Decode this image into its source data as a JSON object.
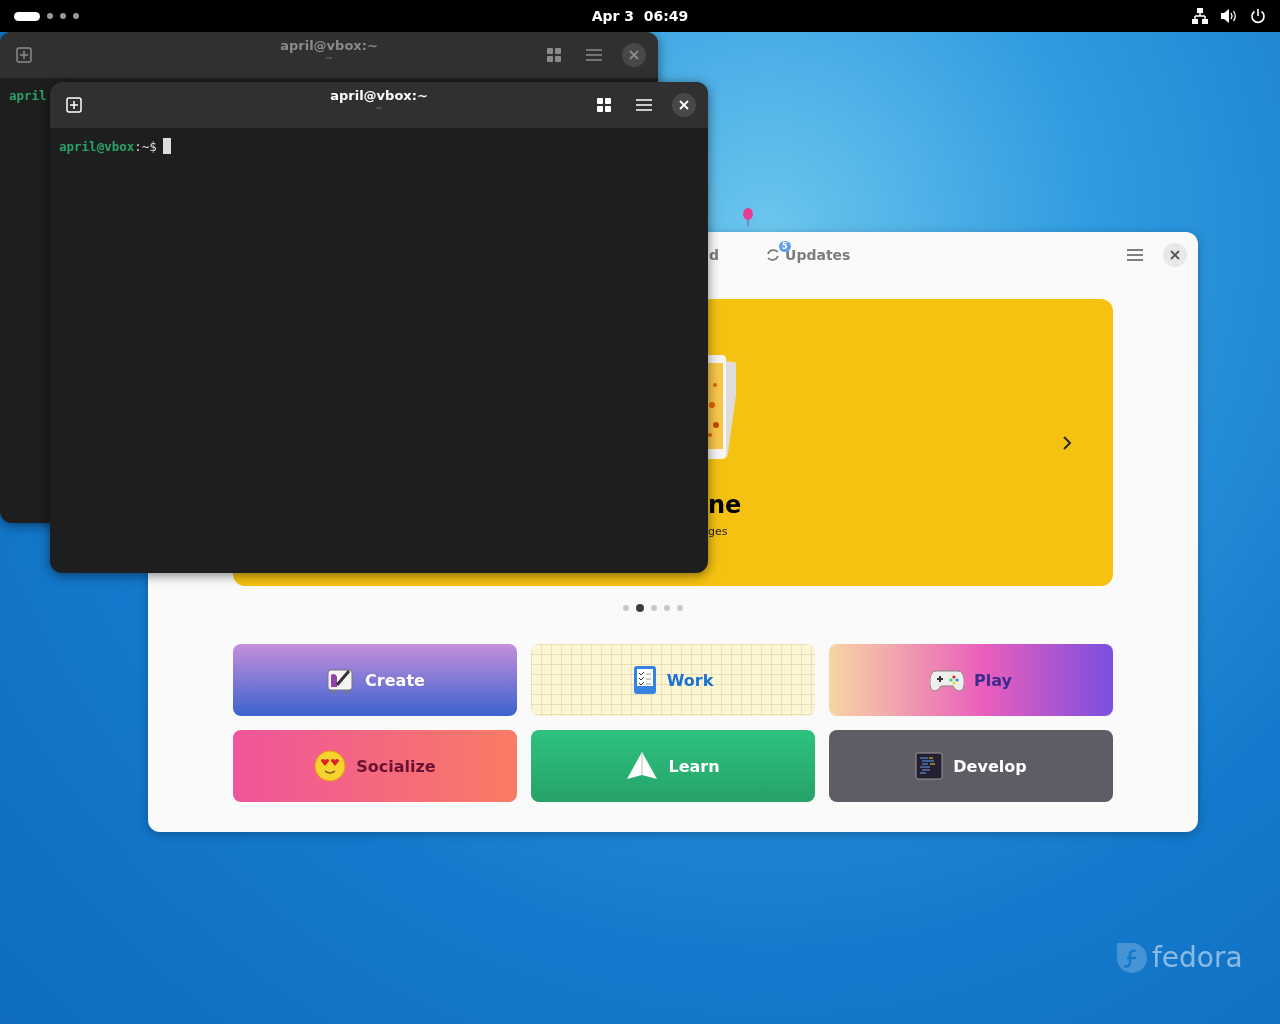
{
  "top_bar": {
    "workspaces": [
      {
        "selected": true
      },
      {
        "selected": false
      },
      {
        "selected": false
      },
      {
        "selected": false
      }
    ],
    "clock": "Apr 3  06:49"
  },
  "wallpaper": {
    "logo": "fedora"
  },
  "software": {
    "tabs": [
      {
        "label": "d",
        "selected": false
      },
      {
        "label": "Updates",
        "selected": false,
        "badge": "5"
      }
    ],
    "featured": {
      "title": "ne",
      "subtitle": "ges"
    },
    "carousel": [
      {
        "selected": false
      },
      {
        "selected": true
      },
      {
        "selected": false
      },
      {
        "selected": false
      },
      {
        "selected": false
      }
    ],
    "categories": [
      {
        "label": "Create",
        "kind": "create"
      },
      {
        "label": "Work",
        "kind": "work"
      },
      {
        "label": "Play",
        "kind": "play"
      },
      {
        "label": "Socialize",
        "kind": "socialize"
      },
      {
        "label": "Learn",
        "kind": "learn"
      },
      {
        "label": "Develop",
        "kind": "develop"
      }
    ]
  },
  "terminals": [
    {
      "title": "april@vbox:~",
      "subtitle": "~",
      "focused": false,
      "prompt": {
        "user": "april"
      },
      "cursor": false
    },
    {
      "title": "april@vbox:~",
      "subtitle": "~",
      "focused": true,
      "prompt": {
        "user": "april@vbox",
        "suffix": ":~$"
      },
      "cursor": true
    }
  ]
}
